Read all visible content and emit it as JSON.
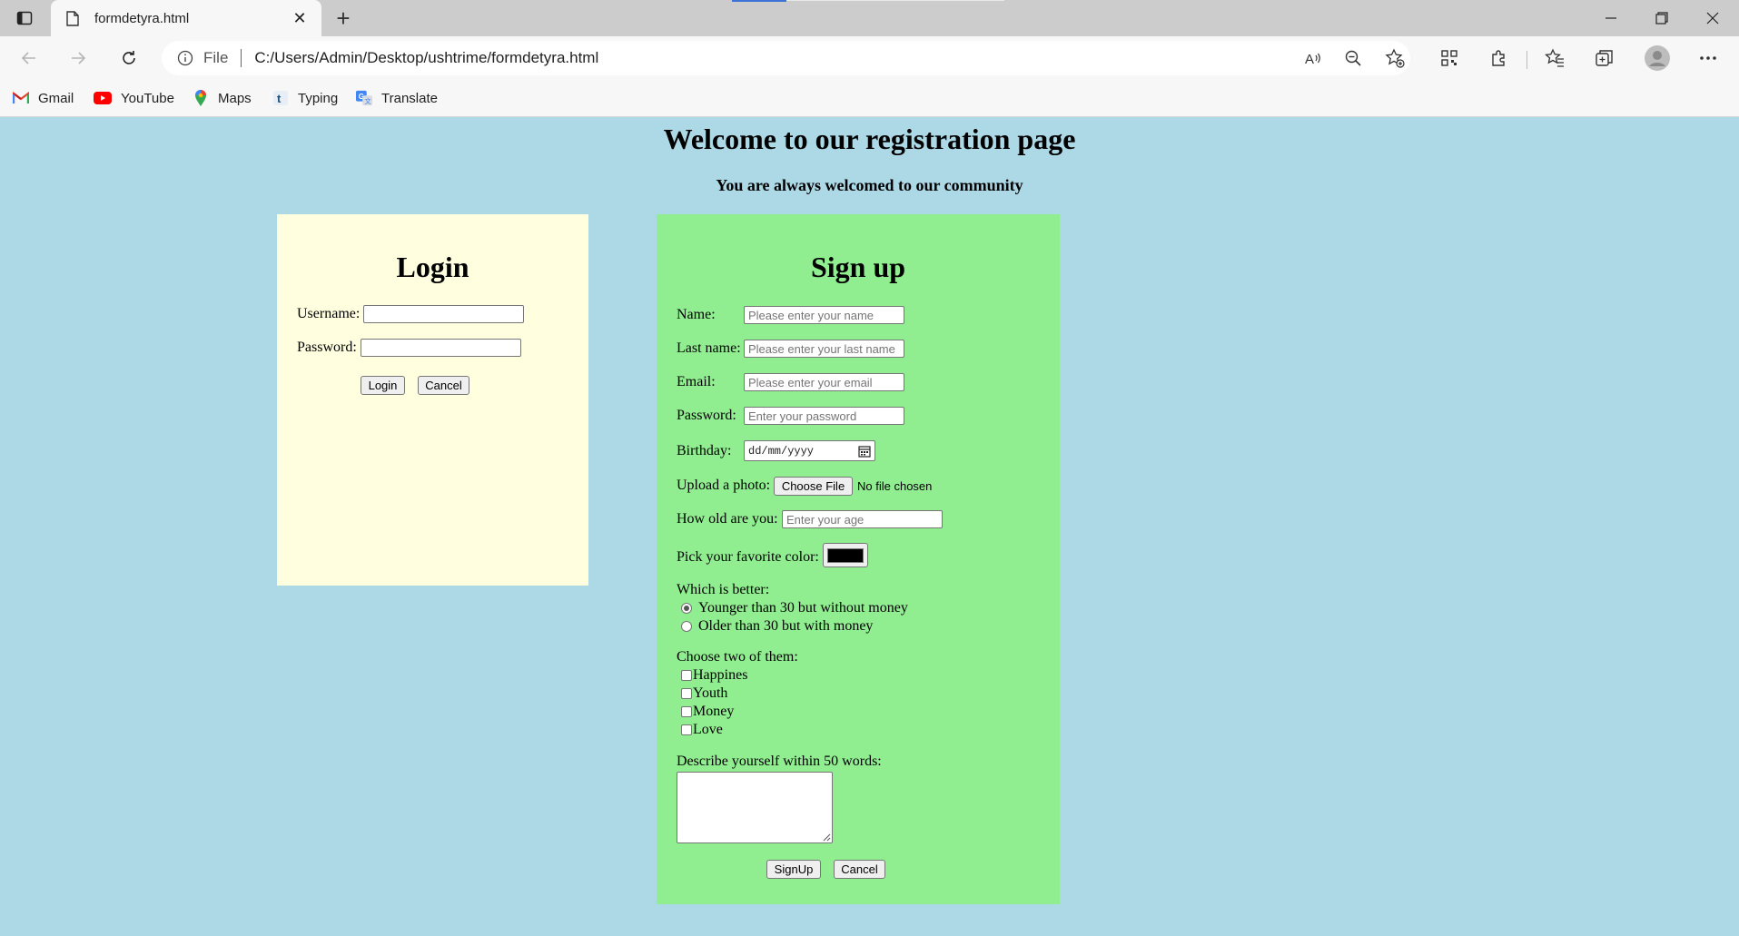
{
  "browser": {
    "tab_title": "formdetyra.html",
    "address_protocol": "File",
    "address_url": "C:/Users/Admin/Desktop/ushtrime/formdetyra.html",
    "bookmarks": [
      {
        "label": "Gmail",
        "icon": "gmail-icon"
      },
      {
        "label": "YouTube",
        "icon": "youtube-icon"
      },
      {
        "label": "Maps",
        "icon": "maps-icon"
      },
      {
        "label": "Typing",
        "icon": "typing-icon"
      },
      {
        "label": "Translate",
        "icon": "translate-icon"
      }
    ]
  },
  "page": {
    "heading": "Welcome to our registration page",
    "subheading": "You are always welcomed to our community"
  },
  "login": {
    "title": "Login",
    "username_label": "Username:",
    "password_label": "Password:",
    "login_button": "Login",
    "cancel_button": "Cancel"
  },
  "signup": {
    "title": "Sign up",
    "name_label": "Name:",
    "name_placeholder": "Please enter your name",
    "lastname_label": "Last name:",
    "lastname_placeholder": "Please enter your last name",
    "email_label": "Email:",
    "email_placeholder": "Please enter your email",
    "password_label": "Password:",
    "password_placeholder": "Enter your password",
    "birthday_label": "Birthday:",
    "birthday_placeholder": "dd/mm/yyyy",
    "photo_label": "Upload a photo:",
    "choose_file_button": "Choose File",
    "no_file_text": "No file chosen",
    "age_label": "How old are you:",
    "age_placeholder": "Enter your age",
    "color_label": "Pick your favorite color:",
    "color_value": "#000000",
    "better_label": "Which is better:",
    "better_options": [
      {
        "label": "Younger than 30 but without money",
        "checked": true
      },
      {
        "label": "Older than 30 but with money",
        "checked": false
      }
    ],
    "choose_label": "Choose two of them:",
    "choose_options": [
      "Happines",
      "Youth",
      "Money",
      "Love"
    ],
    "describe_label": "Describe yourself within 50 words:",
    "signup_button": "SignUp",
    "cancel_button": "Cancel"
  }
}
